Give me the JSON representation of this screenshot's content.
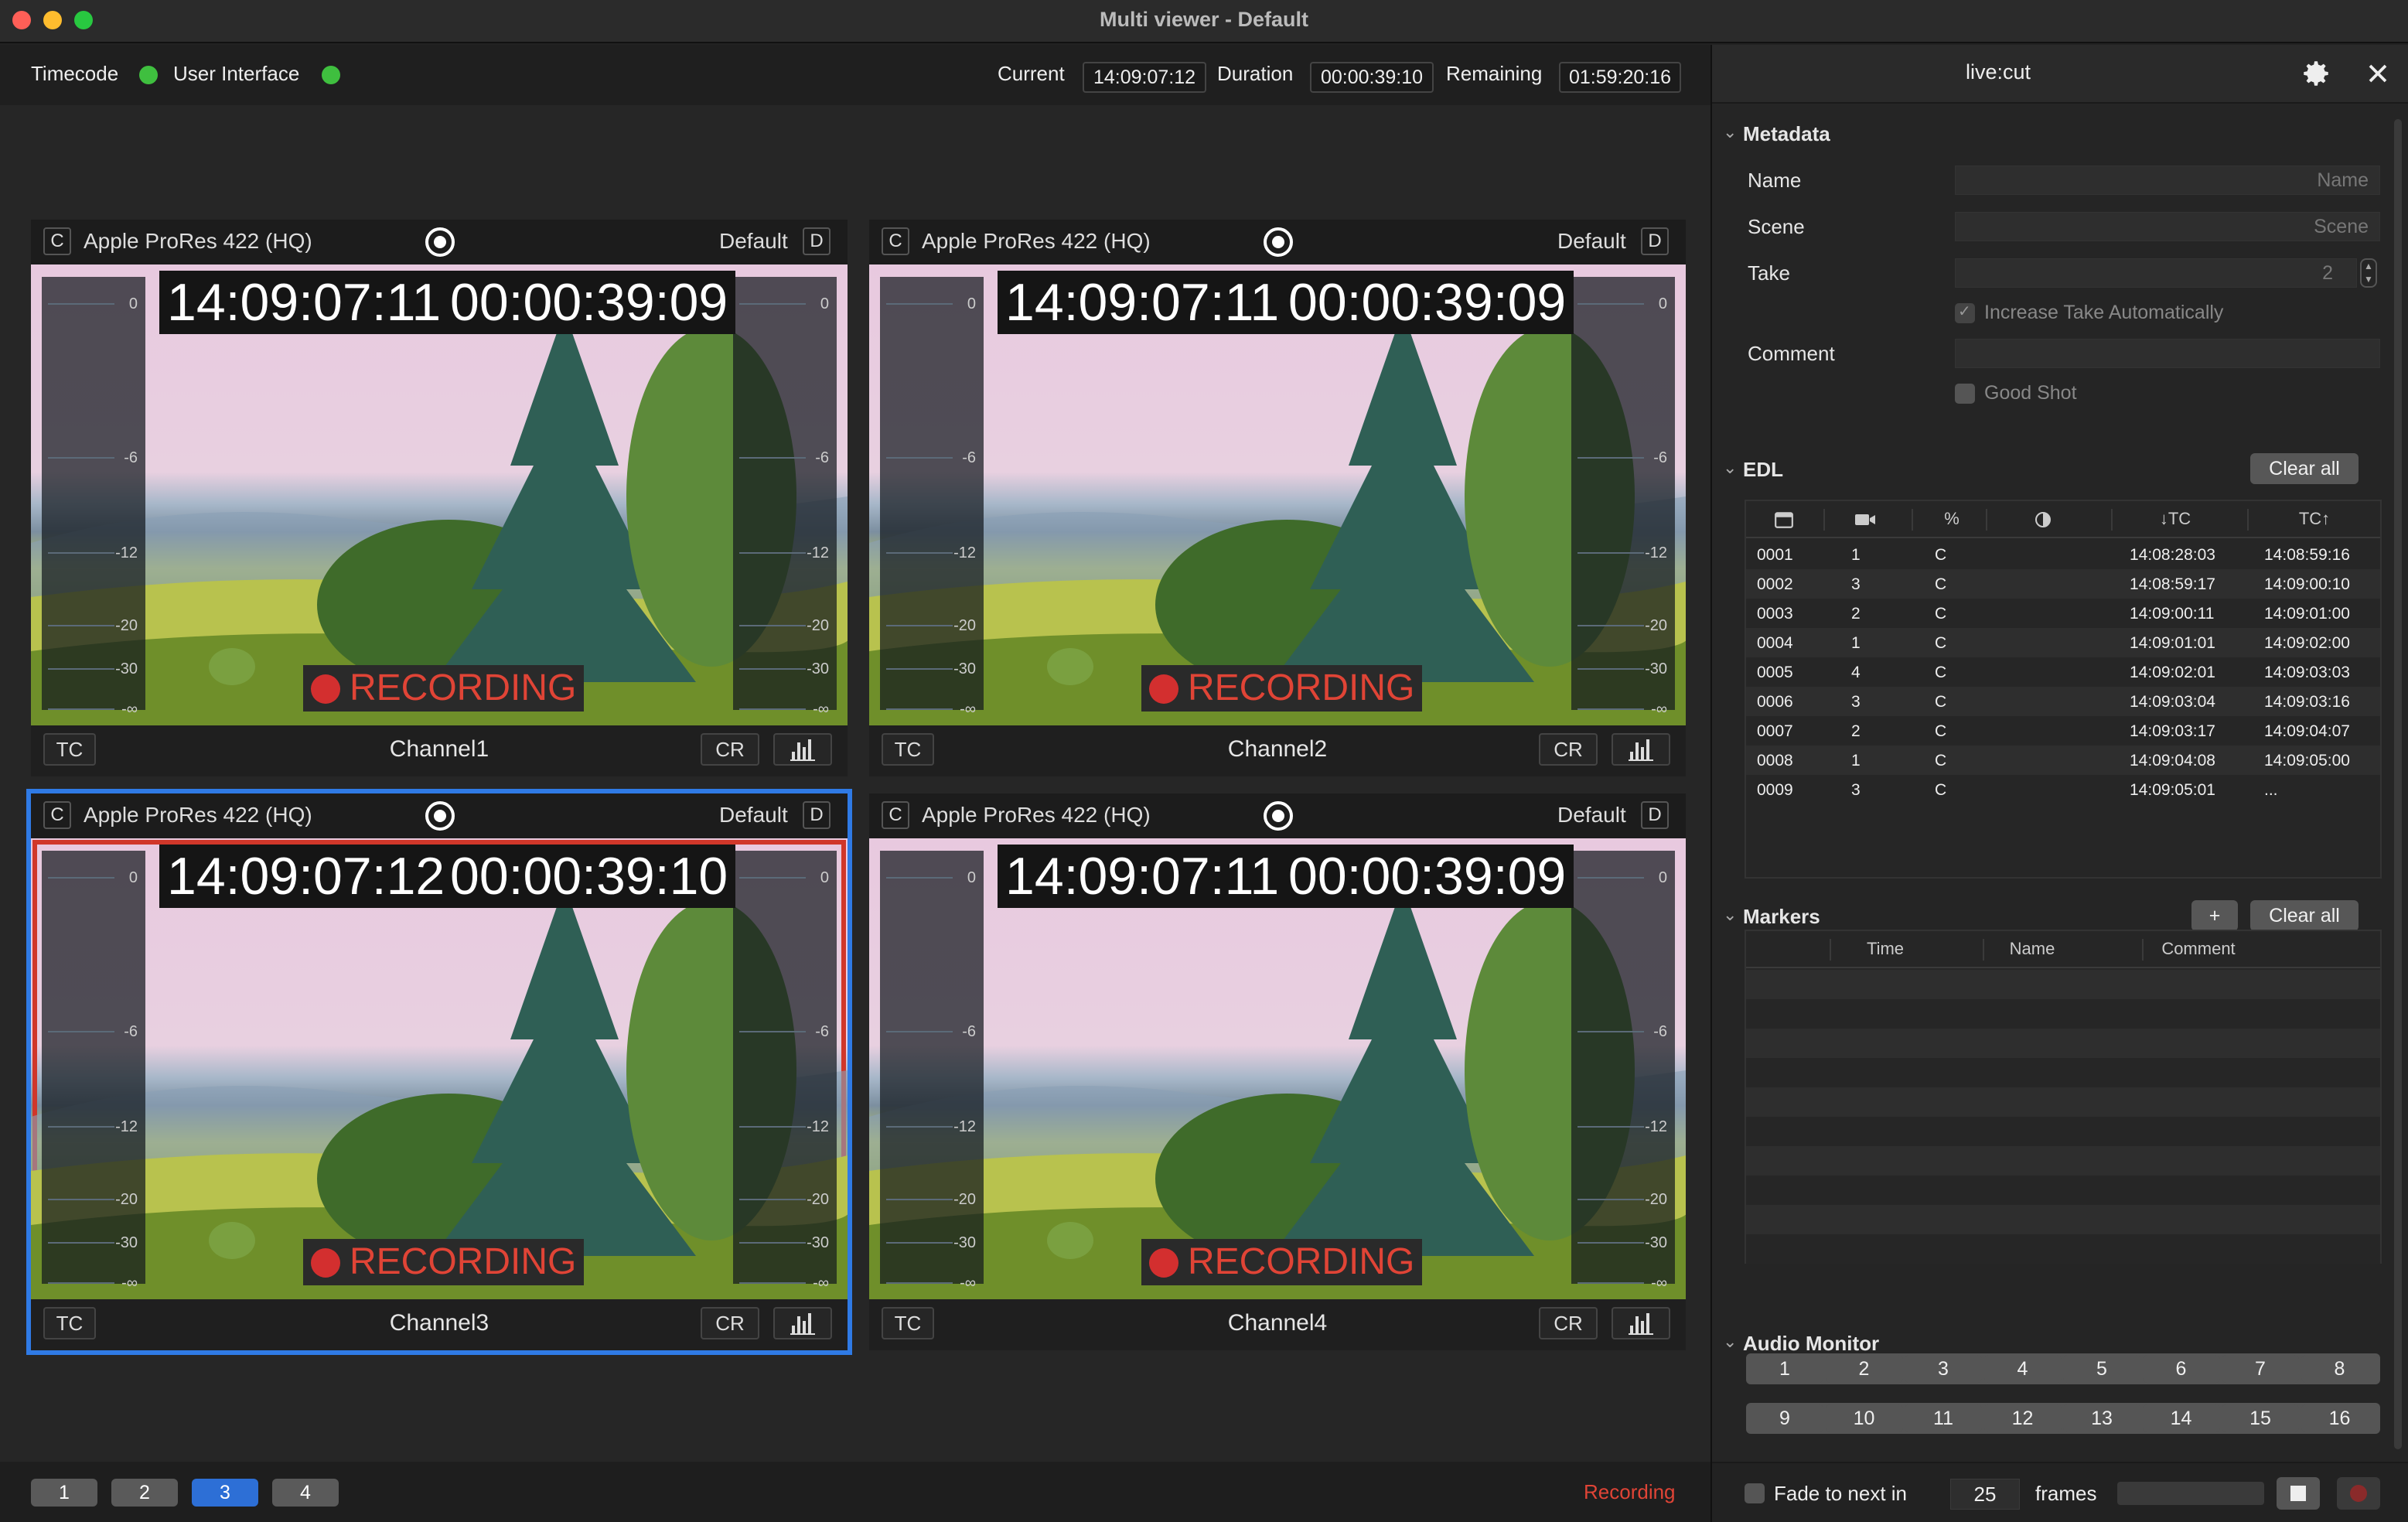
{
  "window": {
    "title": "Multi viewer - Default"
  },
  "status": {
    "timecode_label": "Timecode",
    "ui_label": "User Interface",
    "current_label": "Current",
    "current_value": "14:09:07:12",
    "duration_label": "Duration",
    "duration_value": "00:00:39:10",
    "remaining_label": "Remaining",
    "remaining_value": "01:59:20:16"
  },
  "panels": [
    {
      "c": "C",
      "codec": "Apple ProRes 422 (HQ)",
      "preset": "Default",
      "d": "D",
      "tc": "14:09:07:11",
      "dur": "00:00:39:09",
      "rec": "RECORDING",
      "tcbtn": "TC",
      "name": "Channel1",
      "cr": "CR"
    },
    {
      "c": "C",
      "codec": "Apple ProRes 422 (HQ)",
      "preset": "Default",
      "d": "D",
      "tc": "14:09:07:11",
      "dur": "00:00:39:09",
      "rec": "RECORDING",
      "tcbtn": "TC",
      "name": "Channel2",
      "cr": "CR"
    },
    {
      "c": "C",
      "codec": "Apple ProRes 422 (HQ)",
      "preset": "Default",
      "d": "D",
      "tc": "14:09:07:12",
      "dur": "00:00:39:10",
      "rec": "RECORDING",
      "tcbtn": "TC",
      "name": "Channel3",
      "cr": "CR"
    },
    {
      "c": "C",
      "codec": "Apple ProRes 422 (HQ)",
      "preset": "Default",
      "d": "D",
      "tc": "14:09:07:11",
      "dur": "00:00:39:09",
      "rec": "RECORDING",
      "tcbtn": "TC",
      "name": "Channel4",
      "cr": "CR"
    }
  ],
  "meter_ticks": [
    "0",
    "-6",
    "-12",
    "-20",
    "-30",
    "-∞"
  ],
  "pages": [
    "1",
    "2",
    "3",
    "4"
  ],
  "recording_status": "Recording",
  "side": {
    "title": "live:cut",
    "metadata": {
      "section": "Metadata",
      "name_label": "Name",
      "name_placeholder": "Name",
      "scene_label": "Scene",
      "scene_placeholder": "Scene",
      "take_label": "Take",
      "take_value": "2",
      "increase_label": "Increase Take Automatically",
      "comment_label": "Comment",
      "good_shot_label": "Good Shot"
    },
    "edl": {
      "section": "EDL",
      "clear": "Clear all",
      "headers": [
        "",
        "",
        "%",
        "",
        "↓TC",
        "TC↑"
      ],
      "rows": [
        [
          "0001",
          "1",
          "C",
          "14:08:28:03",
          "14:08:59:16"
        ],
        [
          "0002",
          "3",
          "C",
          "14:08:59:17",
          "14:09:00:10"
        ],
        [
          "0003",
          "2",
          "C",
          "14:09:00:11",
          "14:09:01:00"
        ],
        [
          "0004",
          "1",
          "C",
          "14:09:01:01",
          "14:09:02:00"
        ],
        [
          "0005",
          "4",
          "C",
          "14:09:02:01",
          "14:09:03:03"
        ],
        [
          "0006",
          "3",
          "C",
          "14:09:03:04",
          "14:09:03:16"
        ],
        [
          "0007",
          "2",
          "C",
          "14:09:03:17",
          "14:09:04:07"
        ],
        [
          "0008",
          "1",
          "C",
          "14:09:04:08",
          "14:09:05:00"
        ],
        [
          "0009",
          "3",
          "C",
          "14:09:05:01",
          "..."
        ]
      ]
    },
    "markers": {
      "section": "Markers",
      "add": "+",
      "clear": "Clear all",
      "headers": [
        "Time",
        "Name",
        "Comment"
      ]
    },
    "audio": {
      "section": "Audio Monitor",
      "row1": [
        "1",
        "2",
        "3",
        "4",
        "5",
        "6",
        "7",
        "8"
      ],
      "row2": [
        "9",
        "10",
        "11",
        "12",
        "13",
        "14",
        "15",
        "16"
      ]
    },
    "footer": {
      "fade_label": "Fade to next in",
      "frames_value": "25",
      "frames_label": "frames"
    }
  },
  "colors": {
    "accent": "#2f7ae5",
    "recording": "#e04436",
    "status_ok": "#3fbf3f"
  }
}
